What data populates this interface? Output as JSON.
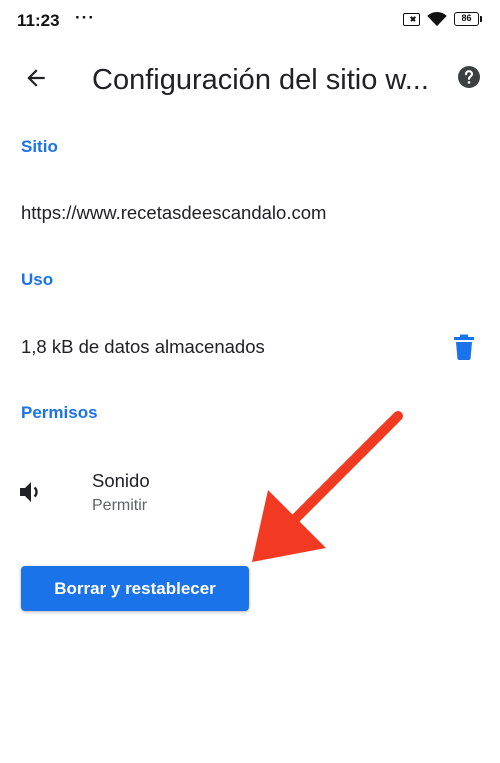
{
  "status_bar": {
    "time": "11:23",
    "dots": "···",
    "battery": "86"
  },
  "app_bar": {
    "title": "Configuración del sitio w...",
    "back_icon": "arrow-left-icon",
    "help_icon": "help-circle-icon"
  },
  "site_section": {
    "header": "Sitio",
    "url": "https://www.recetasdeescandalo.com"
  },
  "usage_section": {
    "header": "Uso",
    "storage_text": "1,8 kB de datos almacenados",
    "delete_icon": "trash-icon"
  },
  "permissions_section": {
    "header": "Permisos",
    "items": [
      {
        "icon": "volume-icon",
        "title": "Sonido",
        "value": "Permitir"
      }
    ]
  },
  "reset_button": {
    "label": "Borrar y restablecer"
  },
  "colors": {
    "accent": "#1a73e8",
    "annotation_arrow": "#f23a22",
    "text_primary": "#202124",
    "text_secondary": "#5f6368"
  }
}
